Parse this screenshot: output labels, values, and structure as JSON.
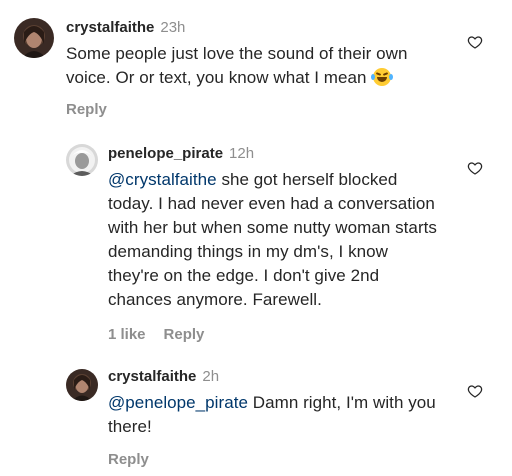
{
  "comments": [
    {
      "username": "crystalfaithe",
      "time": "23h",
      "text": "Some people just love the sound of their own voice. Or or text, you know what I mean",
      "emoji_icon": "face-with-tears-of-joy-icon",
      "reply_label": "Reply"
    },
    {
      "username": "penelope_pirate",
      "time": "12h",
      "mention": "@crystalfaithe",
      "text": " she got herself blocked today. I had never even had a conversation with her but when some nutty woman starts demanding things in my dm's,  I know they're on the edge. I don't give 2nd chances anymore. Farewell.",
      "likes_label": "1 like",
      "reply_label": "Reply"
    },
    {
      "username": "crystalfaithe",
      "time": "2h",
      "mention": "@penelope_pirate",
      "text": " Damn right, I'm with you there!",
      "reply_label": "Reply"
    }
  ],
  "colors": {
    "text": "#262626",
    "secondary": "#8e8e8e",
    "mention": "#00376b"
  },
  "icons": {
    "like": "heart-outline-icon"
  }
}
